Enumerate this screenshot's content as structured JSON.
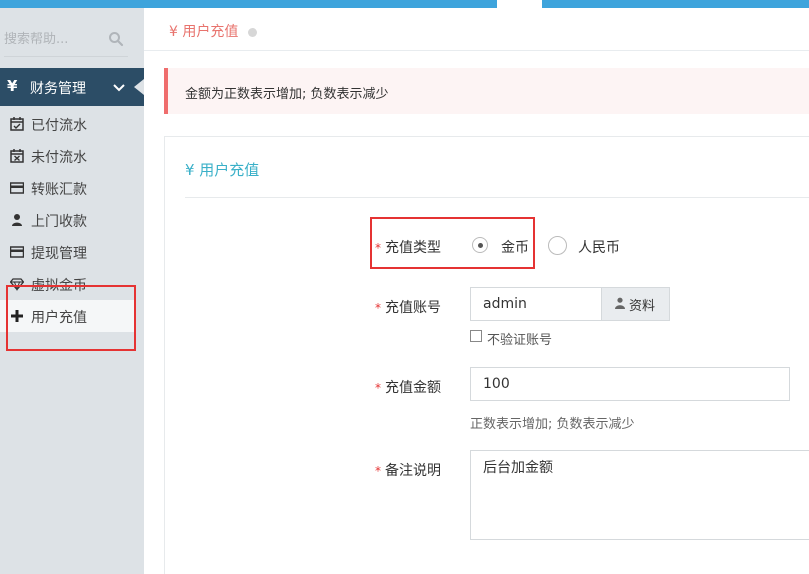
{
  "sidebar": {
    "search_placeholder": "搜索帮助...",
    "group_label": "财务管理",
    "group_icon": "yen-icon",
    "items": [
      {
        "label": "已付流水",
        "icon": "calendar-check-icon"
      },
      {
        "label": "未付流水",
        "icon": "calendar-x-icon"
      },
      {
        "label": "转账汇款",
        "icon": "credit-card-icon"
      },
      {
        "label": "上门收款",
        "icon": "user-icon"
      },
      {
        "label": "提现管理",
        "icon": "credit-card-icon"
      },
      {
        "label": "虚拟金币",
        "icon": "diamond-icon"
      },
      {
        "label": "用户充值",
        "icon": "plus-icon"
      }
    ]
  },
  "breadcrumb": {
    "label": "¥ 用户充值"
  },
  "alert": {
    "text": "金额为正数表示增加; 负数表示减少"
  },
  "panel": {
    "title": "¥ 用户充值"
  },
  "form": {
    "type_label": "充值类型",
    "type_options": [
      "金币",
      "人民币"
    ],
    "type_selected": "金币",
    "account_label": "充值账号",
    "account_value": "admin",
    "account_addon": "资料",
    "skip_verify_label": "不验证账号",
    "amount_label": "充值金额",
    "amount_value": "100",
    "amount_hint": "正数表示增加; 负数表示减少",
    "note_label": "备注说明",
    "note_value": "后台加金额"
  },
  "colors": {
    "topbar": "#3ea4dc",
    "sidebar_active_header": "#2c4d66",
    "accent_red": "#e53333",
    "panel_title": "#3ab0c8"
  }
}
